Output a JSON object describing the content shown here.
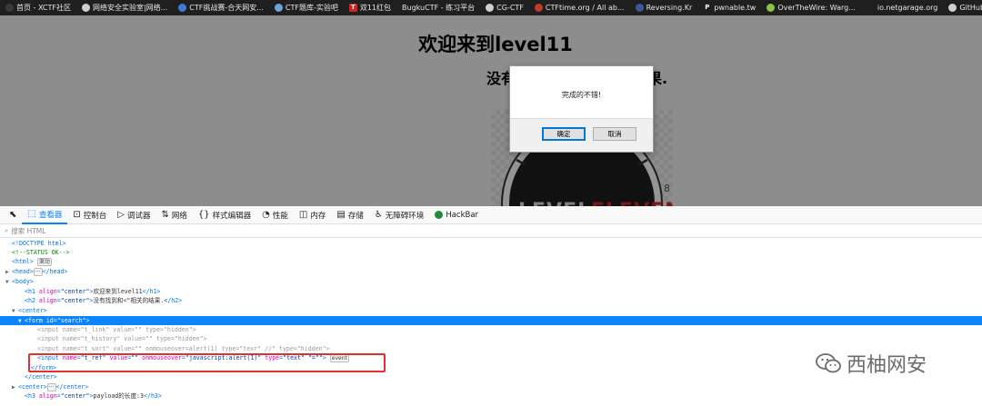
{
  "bookmarks": [
    {
      "label": "首页 - XCTF社区",
      "icon": "xctf-icon",
      "color": "#3a3a3a"
    },
    {
      "label": "网络安全实验室|网络...",
      "icon": "globe-icon",
      "color": "#cfcfcf"
    },
    {
      "label": "CTF挑战赛-合天网安...",
      "icon": "shield-icon",
      "color": "#3d7bd9"
    },
    {
      "label": "CTF题库-实验吧",
      "icon": "lab-icon",
      "color": "#6aa3e0"
    },
    {
      "label": "双11红包",
      "icon": "t-icon",
      "color": "#d71f1f"
    },
    {
      "label": "BugkuCTF - 练习平台",
      "icon": "",
      "color": ""
    },
    {
      "label": "CG-CTF",
      "icon": "globe-icon",
      "color": "#cfcfcf"
    },
    {
      "label": "CTFtime.org / All ab...",
      "icon": "ctftime-icon",
      "color": "#c0392b"
    },
    {
      "label": "Reversing.Kr",
      "icon": "reversing-icon",
      "color": "#3b5998"
    },
    {
      "label": "pwnable.tw",
      "icon": "p-icon",
      "color": ""
    },
    {
      "label": "OverTheWire: Warg...",
      "icon": "otw-icon",
      "color": "#8bc34a"
    },
    {
      "label": "io.netgarage.org",
      "icon": "io-icon",
      "color": ""
    },
    {
      "label": "GitHub - Auc",
      "icon": "github-icon",
      "color": "#cfcfcf"
    }
  ],
  "page": {
    "h1": "欢迎来到level11",
    "h2_start": "没有",
    "h2_end": "果."
  },
  "dialog": {
    "message": "完成的不错!",
    "ok_label": "确定",
    "cancel_label": "取消"
  },
  "devtools": {
    "tabs": [
      {
        "label": "查看器",
        "icon": "inspector-icon",
        "glyph": "⬚",
        "active": true
      },
      {
        "label": "控制台",
        "icon": "console-icon",
        "glyph": "⊡",
        "active": false
      },
      {
        "label": "调试器",
        "icon": "debugger-icon",
        "glyph": "▷",
        "active": false
      },
      {
        "label": "网络",
        "icon": "network-icon",
        "glyph": "⇅",
        "active": false
      },
      {
        "label": "样式编辑器",
        "icon": "style-editor-icon",
        "glyph": "{}",
        "active": false
      },
      {
        "label": "性能",
        "icon": "performance-icon",
        "glyph": "◔",
        "active": false
      },
      {
        "label": "内存",
        "icon": "memory-icon",
        "glyph": "◫",
        "active": false
      },
      {
        "label": "存储",
        "icon": "storage-icon",
        "glyph": "▤",
        "active": false
      },
      {
        "label": "无障碍环境",
        "icon": "accessibility-icon",
        "glyph": "♿",
        "active": false
      },
      {
        "label": "HackBar",
        "icon": "hackbar-icon",
        "glyph": "",
        "active": false
      }
    ],
    "search_placeholder": "搜索 HTML",
    "tree": [
      {
        "indent": 0,
        "twisty": "",
        "parts": [
          [
            "tag",
            "<!DOCTYPE html>"
          ]
        ]
      },
      {
        "indent": 0,
        "twisty": "",
        "parts": [
          [
            "cm",
            "<!--STATUS OK-->"
          ]
        ]
      },
      {
        "indent": 0,
        "twisty": "",
        "parts": [
          [
            "tag",
            "<html>"
          ],
          [
            "txt",
            " "
          ],
          [
            "pill",
            "滚动"
          ]
        ]
      },
      {
        "indent": 0,
        "twisty": "▶",
        "parts": [
          [
            "tag",
            "<head>"
          ],
          [
            "pill",
            "···"
          ],
          [
            "tag",
            "</head>"
          ]
        ]
      },
      {
        "indent": 0,
        "twisty": "▼",
        "parts": [
          [
            "tag",
            "<body>"
          ]
        ]
      },
      {
        "indent": 2,
        "twisty": "",
        "parts": [
          [
            "tag",
            "<h1 "
          ],
          [
            "an",
            "align"
          ],
          [
            "tag",
            "="
          ],
          [
            "av",
            "\"center\""
          ],
          [
            "tag",
            ">"
          ],
          [
            "txt",
            "欢迎来到level11"
          ],
          [
            "tag",
            "</h1>"
          ]
        ]
      },
      {
        "indent": 2,
        "twisty": "",
        "parts": [
          [
            "tag",
            "<h2 "
          ],
          [
            "an",
            "align"
          ],
          [
            "tag",
            "="
          ],
          [
            "av",
            "\"center\""
          ],
          [
            "tag",
            ">"
          ],
          [
            "txt",
            "没有找到和<\"相关的结果.<"
          ],
          [
            "tag",
            "/h2>"
          ]
        ]
      },
      {
        "indent": 1,
        "twisty": "▼",
        "parts": [
          [
            "tag",
            "<center>"
          ]
        ]
      },
      {
        "indent": 2,
        "twisty": "▼",
        "sel": true,
        "parts": [
          [
            "tag",
            "<form "
          ],
          [
            "an",
            "id"
          ],
          [
            "tag",
            "="
          ],
          [
            "av",
            "\"search\""
          ],
          [
            "tag",
            ">"
          ]
        ]
      },
      {
        "indent": 4,
        "twisty": "",
        "parts": [
          [
            "gray",
            "<input name=\"t_link\" value=\"\" type=\"hidden\">"
          ]
        ]
      },
      {
        "indent": 4,
        "twisty": "",
        "parts": [
          [
            "gray",
            "<input name=\"t_history\" value=\"\" type=\"hidden\">"
          ]
        ]
      },
      {
        "indent": 4,
        "twisty": "",
        "parts": [
          [
            "gray",
            "<input name=\"t_sort\" value=\"\" onmouseover=alert(1) type=\"texr\" //\" type=\"hidden\">"
          ]
        ]
      },
      {
        "indent": 4,
        "twisty": "",
        "parts": [
          [
            "tag",
            "<input "
          ],
          [
            "an",
            "name"
          ],
          [
            "tag",
            "="
          ],
          [
            "av",
            "\"t_ref\""
          ],
          [
            "txt",
            " "
          ],
          [
            "an",
            "value"
          ],
          [
            "tag",
            "="
          ],
          [
            "av",
            "\"\""
          ],
          [
            "txt",
            " "
          ],
          [
            "an",
            "onmouseover"
          ],
          [
            "tag",
            "="
          ],
          [
            "av",
            "\"javascript:alert(1)\""
          ],
          [
            "txt",
            " "
          ],
          [
            "an",
            "type"
          ],
          [
            "tag",
            "="
          ],
          [
            "av",
            "\"text\""
          ],
          [
            "txt",
            " "
          ],
          [
            "av",
            "\"=\"\""
          ],
          [
            "tag",
            ">"
          ],
          [
            "txt",
            " "
          ],
          [
            "pill",
            "event"
          ]
        ]
      },
      {
        "indent": 3,
        "twisty": "",
        "parts": [
          [
            "tag",
            "</form>"
          ]
        ]
      },
      {
        "indent": 2,
        "twisty": "",
        "parts": [
          [
            "tag",
            "</center>"
          ]
        ]
      },
      {
        "indent": 1,
        "twisty": "▶",
        "parts": [
          [
            "tag",
            "<center>"
          ],
          [
            "pill",
            "···"
          ],
          [
            "tag",
            "</center>"
          ]
        ]
      },
      {
        "indent": 2,
        "twisty": "",
        "parts": [
          [
            "tag",
            "<h3 "
          ],
          [
            "an",
            "align"
          ],
          [
            "tag",
            "="
          ],
          [
            "av",
            "\"center\""
          ],
          [
            "tag",
            ">"
          ],
          [
            "txt",
            "payload的长度:3"
          ],
          [
            "tag",
            "</h3>"
          ]
        ]
      }
    ]
  },
  "watermark": {
    "text": "西柚网安",
    "icon": "wechat-icon"
  }
}
